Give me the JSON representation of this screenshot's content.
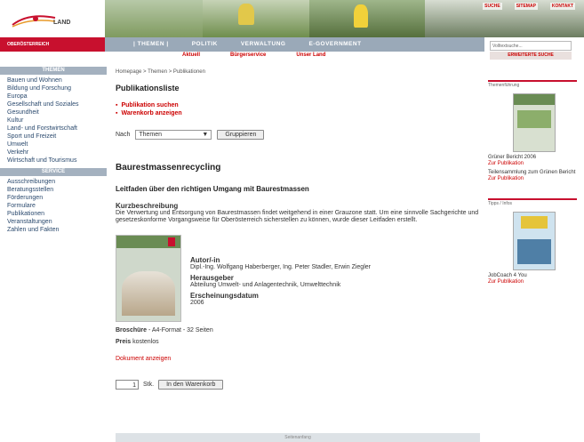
{
  "header": {
    "logo_text": "LAND",
    "brand_label": "OBERÖSTERREICH",
    "top_links": [
      "SUCHE",
      "SITEMAP",
      "KONTAKT"
    ]
  },
  "nav": {
    "items": [
      "| THEMEN |",
      "POLITIK",
      "VERWALTUNG",
      "E-GOVERNMENT"
    ],
    "sub_items": [
      "Aktuell",
      "Bürgerservice",
      "Unser Land"
    ]
  },
  "search": {
    "placeholder": "Volltextsuche...",
    "action_label": "ERWEITERTE SUCHE"
  },
  "sidebar": {
    "sections": [
      {
        "title": "THEMEN",
        "items": [
          "Bauen und Wohnen",
          "Bildung und Forschung",
          "Europa",
          "Gesellschaft und Soziales",
          "Gesundheit",
          "Kultur",
          "Land- und Forstwirtschaft",
          "Sport und Freizeit",
          "Umwelt",
          "Verkehr",
          "Wirtschaft und Tourismus"
        ]
      },
      {
        "title": "SERVICE",
        "items": [
          "Ausschreibungen",
          "Beratungsstellen",
          "Förderungen",
          "Formulare",
          "Publikationen",
          "Veranstaltungen",
          "Zahlen und Fakten"
        ]
      }
    ]
  },
  "main": {
    "breadcrumb": "Homepage > Themen > Publikationen",
    "page_title": "Publikationsliste",
    "links": [
      "Publikation suchen",
      "Warenkorb anzeigen"
    ],
    "sort_label": "Nach",
    "sort_value": "Themen",
    "group_button": "Gruppieren",
    "pub_title": "Baurestmassenrecycling",
    "pub_subtitle": "Leitfaden über den richtigen Umgang mit Baurestmassen",
    "desc_heading": "Kurzbeschreibung",
    "desc_text": "Die Verwertung und Entsorgung von Baurestmassen findet weitgehend in einer Grauzone statt. Um eine sinnvolle Sachgerichte und gesetzeskonforme Vorgangsweise für Oberösterreich sicherstellen zu können, wurde dieser Leitfaden erstellt.",
    "author_label": "Autor/-in",
    "author_value": "Dipl.-Ing. Wolfgang Haberberger, Ing. Peter Stadler, Erwin Ziegler",
    "publisher_label": "Herausgeber",
    "publisher_value": "Abteilung Umwelt- und Anlagentechnik, Umwelttechnik",
    "date_label": "Erscheinungsdatum",
    "date_value": "2006",
    "brochure_label": "Broschüre",
    "brochure_value": "- A4-Format - 32 Seiten",
    "price_label": "Preis",
    "price_value": "kostenlos",
    "doc_link": "Dokument anzeigen",
    "qty_value": "1",
    "qty_unit": "Stk.",
    "cart_button": "In den Warenkorb"
  },
  "right": {
    "box1_head": "Themenführung",
    "box1_items": [
      {
        "text": "Grüner Bericht 2006",
        "link": "Zur Publikation"
      },
      {
        "text": "Teilensammlung zum Grünen Bericht",
        "link": "Zur Publikation"
      }
    ],
    "box2_head": "Tipps / Infos",
    "box2_item": {
      "text": "JobCoach 4 You",
      "link": "Zur Publikation"
    }
  },
  "footer": {
    "label": "Seitenanfang"
  },
  "colors": {
    "brand_red": "#c8102e",
    "nav_gray": "#9aa9b8",
    "link_red": "#cc0000"
  }
}
